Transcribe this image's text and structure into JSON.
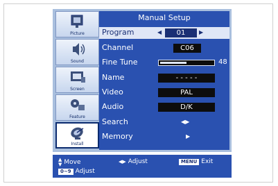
{
  "sidebar": {
    "items": [
      {
        "label": "Picture",
        "icon": "tv-icon"
      },
      {
        "label": "Sound",
        "icon": "speaker-icon"
      },
      {
        "label": "Screen",
        "icon": "screen-icon"
      },
      {
        "label": "Feature",
        "icon": "feature-icon"
      },
      {
        "label": "Install",
        "icon": "satellite-dish-icon",
        "active": true
      }
    ]
  },
  "menu": {
    "title": "Manual Setup",
    "rows": [
      {
        "label": "Program",
        "value": "01"
      },
      {
        "label": "Channel",
        "value": "C06"
      },
      {
        "label": "Fine Tune",
        "value": "48"
      },
      {
        "label": "Name",
        "value": "- - - - -"
      },
      {
        "label": "Video",
        "value": "PAL"
      },
      {
        "label": "Audio",
        "value": "D/K"
      },
      {
        "label": "Search",
        "value": ""
      },
      {
        "label": "Memory",
        "value": ""
      }
    ],
    "fine_tune_level": 0.5
  },
  "footer": {
    "move": "Move",
    "adjust": "Adjust",
    "menu_key": "MENU",
    "exit": "Exit",
    "digit_key": "0~9",
    "digit_adjust": "Adjust"
  },
  "colors": {
    "panel": "#2a51b0",
    "highlight": "#dfe6f6",
    "backdrop": "#a9bfde"
  }
}
